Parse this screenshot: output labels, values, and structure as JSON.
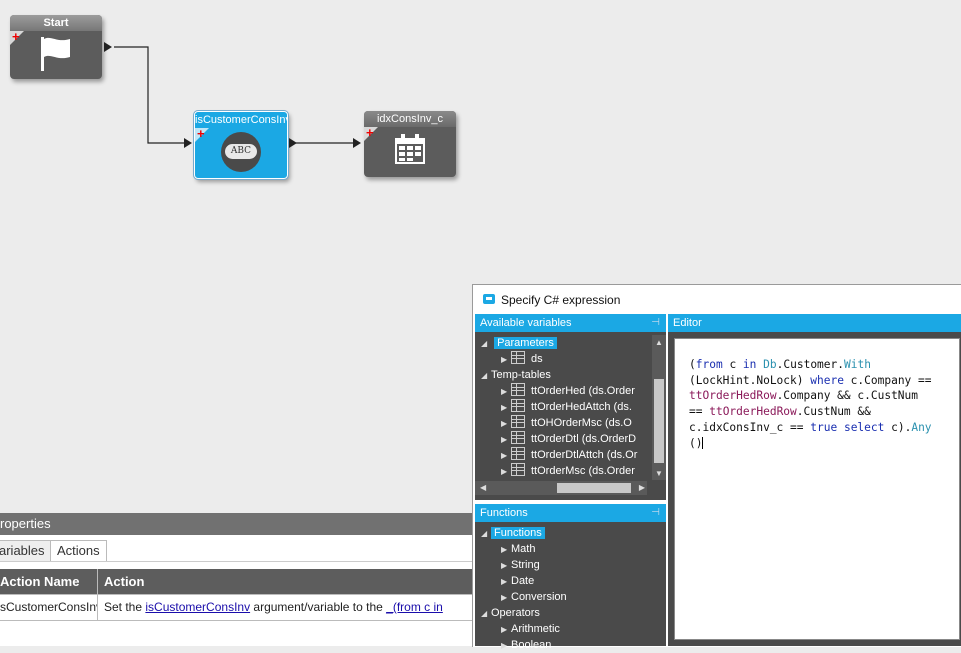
{
  "nodes": {
    "start": {
      "title": "Start",
      "icon": "flag-icon"
    },
    "condition": {
      "title": "isCustomerConsInv",
      "icon_text": "ABC"
    },
    "update": {
      "title": "idxConsInv_c",
      "icon": "calendar-icon"
    }
  },
  "properties": {
    "header": "roperties",
    "tabs": [
      "ariables",
      "Actions"
    ],
    "active_tab": "Actions",
    "columns": [
      "Action Name",
      "Action"
    ],
    "rows": [
      {
        "name": "sCustomerConsInv",
        "action_prefix": "Set the ",
        "action_link1": "isCustomerConsInv",
        "action_mid": " argument/variable to the ",
        "action_link2": "_(from c in"
      }
    ]
  },
  "dialog": {
    "title": "Specify C# expression",
    "variables_pane": {
      "title": "Available variables",
      "items": [
        {
          "label": "Parameters",
          "level": 0,
          "expanded": true,
          "selected": true
        },
        {
          "label": "ds",
          "level": 1,
          "icon": "table-icon"
        },
        {
          "label": "Temp-tables",
          "level": 0,
          "expanded": true
        },
        {
          "label": "ttOrderHed (ds.Order",
          "level": 1,
          "icon": "table-icon"
        },
        {
          "label": "ttOrderHedAttch (ds.",
          "level": 1,
          "icon": "table-icon"
        },
        {
          "label": "ttOHOrderMsc (ds.O",
          "level": 1,
          "icon": "table-icon"
        },
        {
          "label": "ttOrderDtl (ds.OrderD",
          "level": 1,
          "icon": "table-icon"
        },
        {
          "label": "ttOrderDtlAttch (ds.Or",
          "level": 1,
          "icon": "table-icon"
        },
        {
          "label": "ttOrderMsc (ds.Order",
          "level": 1,
          "icon": "table-icon"
        }
      ]
    },
    "functions_pane": {
      "title": "Functions",
      "items": [
        {
          "label": "Functions",
          "level": 0,
          "expanded": true,
          "selected": true
        },
        {
          "label": "Math",
          "level": 1
        },
        {
          "label": "String",
          "level": 1
        },
        {
          "label": "Date",
          "level": 1
        },
        {
          "label": "Conversion",
          "level": 1
        },
        {
          "label": "Operators",
          "level": 0,
          "expanded": true
        },
        {
          "label": "Arithmetic",
          "level": 1
        },
        {
          "label": "Boolean",
          "level": 1
        }
      ]
    },
    "editor": {
      "title": "Editor",
      "code_lines": [
        "(from c in Db.Customer.With",
        "(LockHint.NoLock) where c.Company ==",
        "ttOrderHedRow.Company && c.CustNum",
        "== ttOrderHedRow.CustNum &&",
        "c.idxConsInv_c == true select c).Any",
        "()"
      ]
    }
  }
}
